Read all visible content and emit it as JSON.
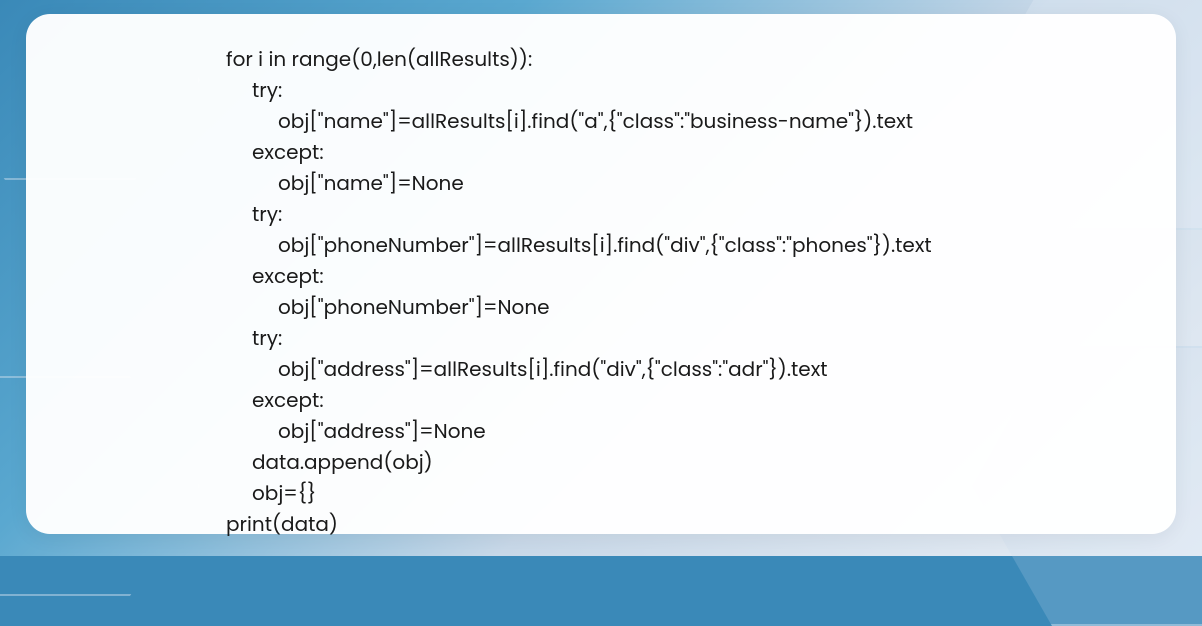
{
  "code": {
    "line1": "for i in range(0,len(allResults)):",
    "line2": "try:",
    "line3": "obj[\"name\"]=allResults[i].find(\"a\",{\"class\":\"business-name\"}).text",
    "line4": "except:",
    "line5": "obj[\"name\"]=None",
    "line6": "try:",
    "line7": "obj[\"phoneNumber\"]=allResults[i].find(\"div\",{\"class\":\"phones\"}).text",
    "line8": "except:",
    "line9": "obj[\"phoneNumber\"]=None",
    "line10": "try:",
    "line11": "obj[\"address\"]=allResults[i].find(\"div\",{\"class\":\"adr\"}).text",
    "line12": "except:",
    "line13": "obj[\"address\"]=None",
    "line14": "data.append(obj)",
    "line15": "obj={}",
    "line16": "print(data)"
  }
}
